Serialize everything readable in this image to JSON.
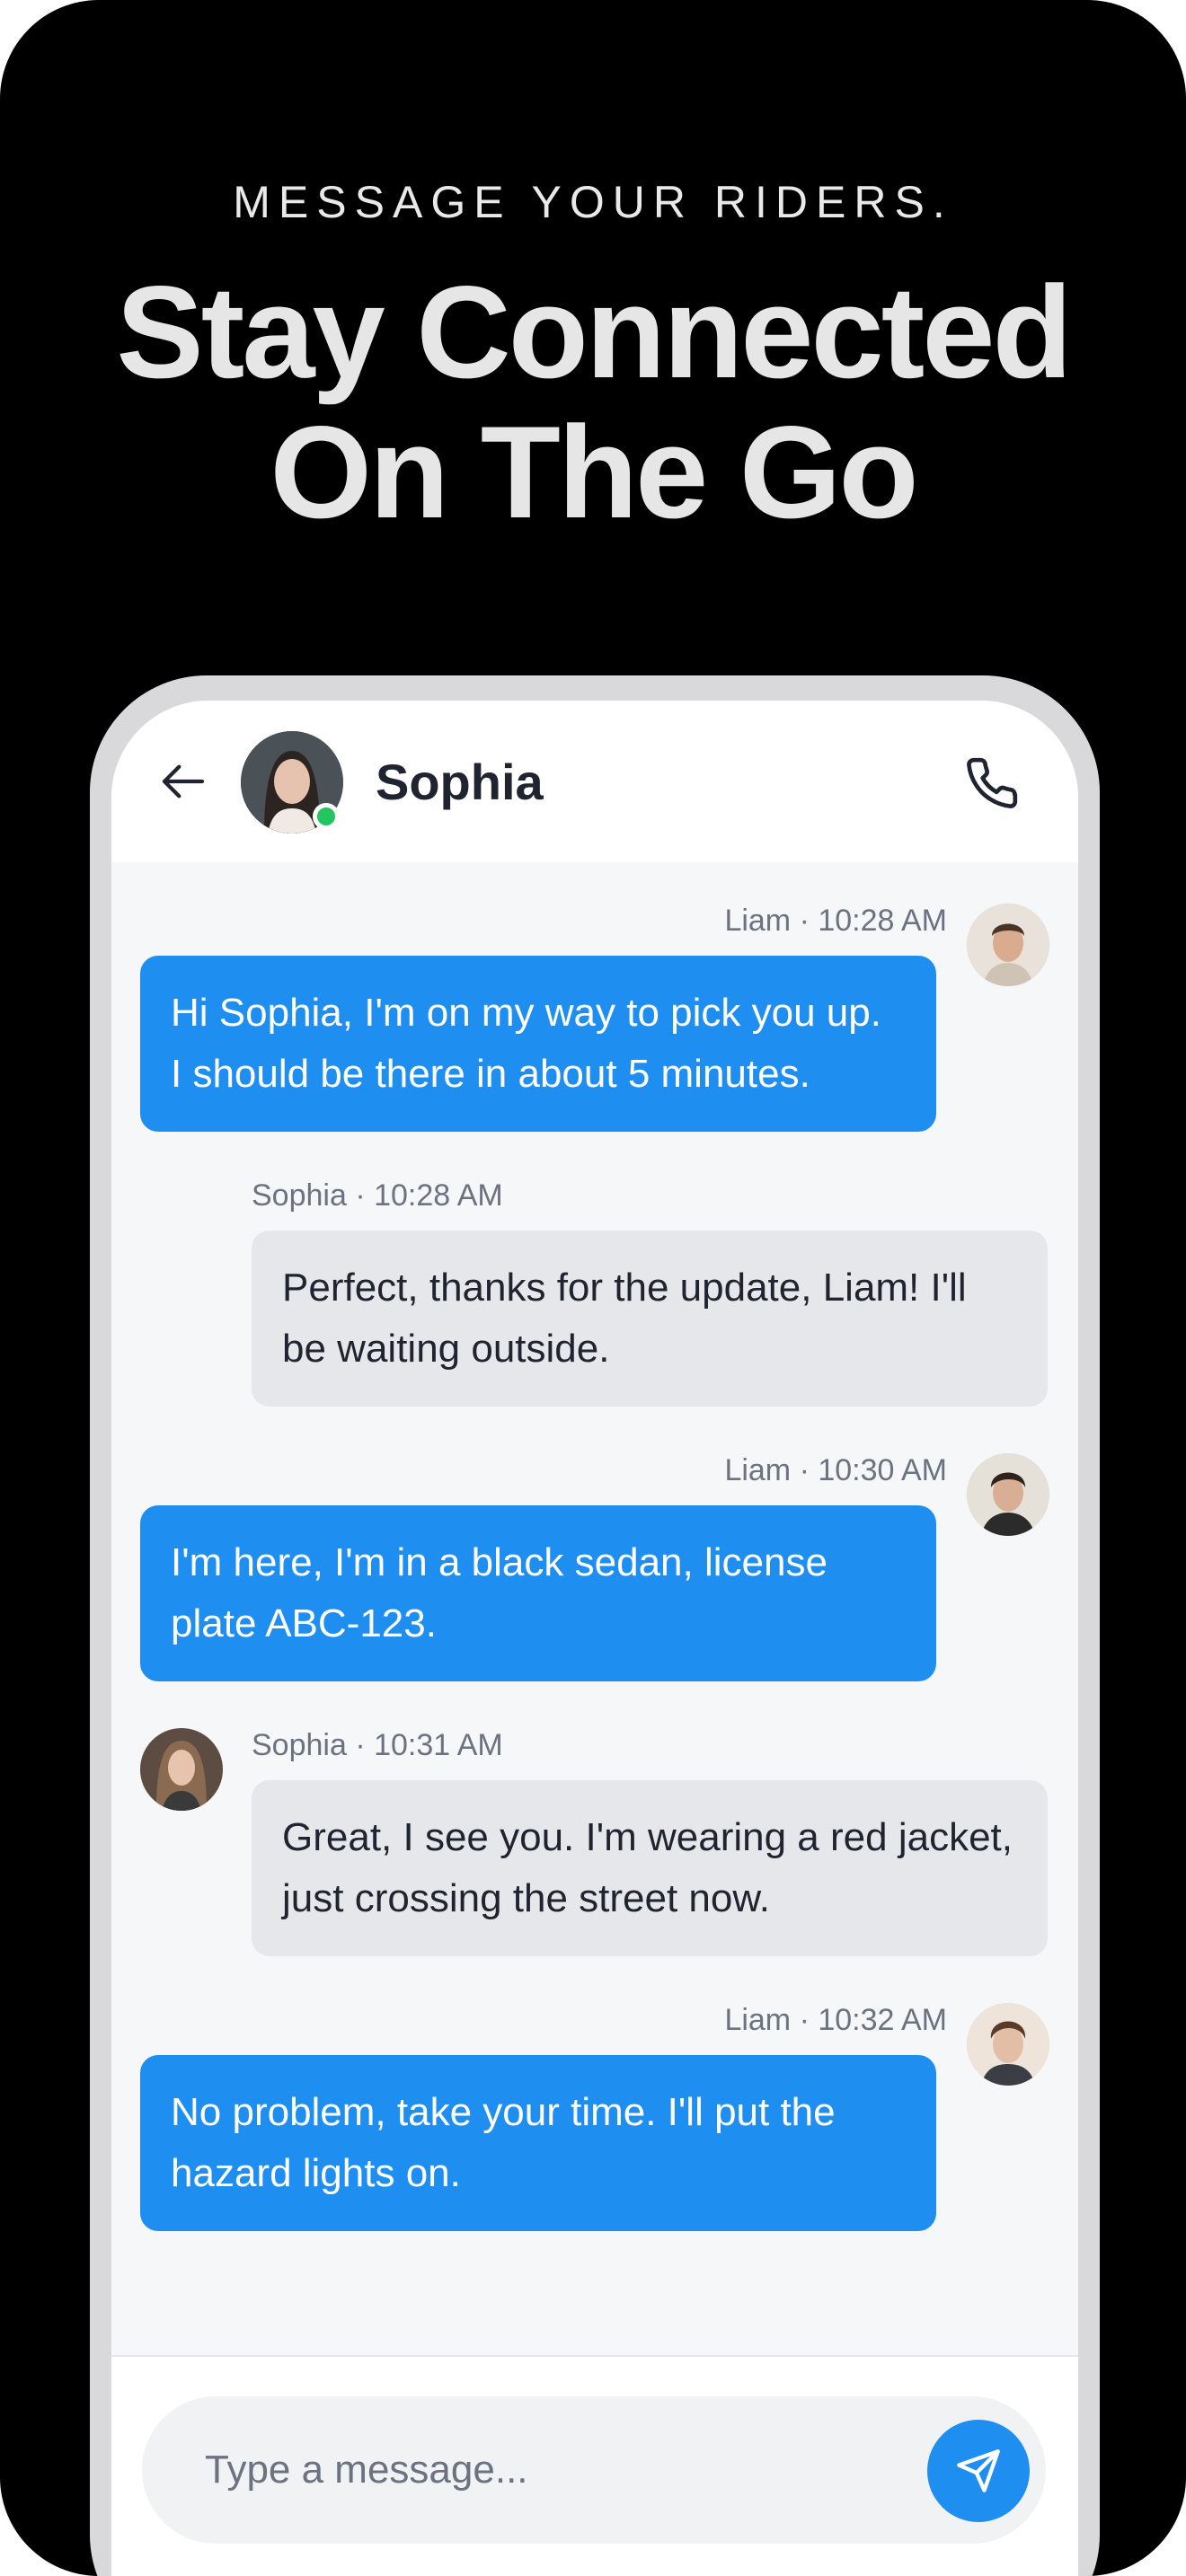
{
  "promo": {
    "eyebrow": "MESSAGE YOUR RIDERS.",
    "headline_line1": "Stay Connected",
    "headline_line2": "On The Go"
  },
  "header": {
    "contact_name": "Sophia",
    "status": "online",
    "back_icon": "arrow-left-icon",
    "call_icon": "phone-icon"
  },
  "messages": [
    {
      "sender": "Liam",
      "meta": "Liam · 10:28 AM",
      "direction": "outgoing",
      "line1": "Hi Sophia, I'm on my way to pick you up.",
      "line2": "I should be there in about 5 minutes."
    },
    {
      "sender": "Sophia",
      "meta": "Sophia · 10:28 AM",
      "direction": "incoming",
      "line1": "Perfect, thanks for the update, Liam! I'll",
      "line2": "be waiting outside."
    },
    {
      "sender": "Liam",
      "meta": "Liam · 10:30 AM",
      "direction": "outgoing",
      "line1": "I'm here, I'm in a black sedan, license",
      "line2": "plate ABC-123."
    },
    {
      "sender": "Sophia",
      "meta": "Sophia · 10:31 AM",
      "direction": "incoming",
      "line1": "Great, I see you. I'm wearing a red jacket,",
      "line2": "just crossing the street now."
    },
    {
      "sender": "Liam",
      "meta": "Liam · 10:32 AM",
      "direction": "outgoing",
      "line1": "No problem, take your time. I'll put the",
      "line2": "hazard lights on."
    }
  ],
  "composer": {
    "placeholder": "Type a message...",
    "send_icon": "send-icon"
  },
  "colors": {
    "background": "#000000",
    "accent": "#1f8ef1",
    "incoming_bubble": "#e6e7ea",
    "online": "#22c55e"
  }
}
